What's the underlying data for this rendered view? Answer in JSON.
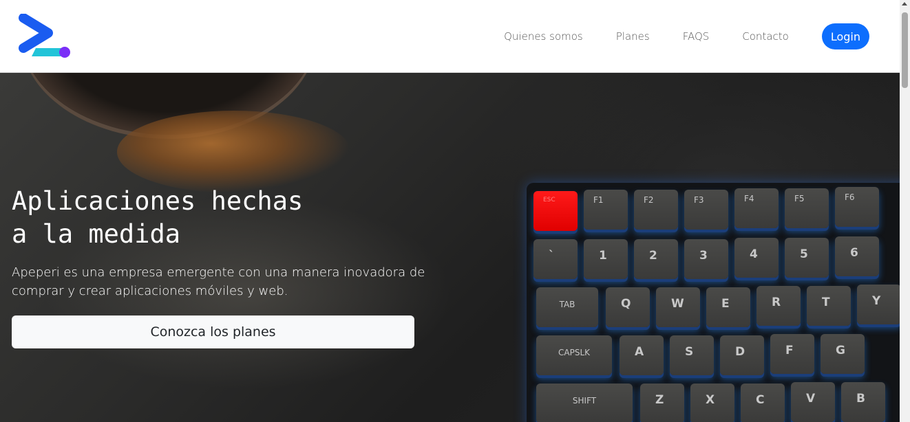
{
  "nav": {
    "links": [
      "Quienes somos",
      "Planes",
      "FAQS",
      "Contacto"
    ],
    "login_label": "Login"
  },
  "hero": {
    "title_line1": "Aplicaciones hechas",
    "title_line2": "a la medida",
    "subtitle": "Apeperi es una empresa emergente con una manera inovadora de comprar y crear aplicaciones móviles y web.",
    "cta_label": "Conozca los planes"
  },
  "keyboard": {
    "function_row": [
      "ESC",
      "F1",
      "F2",
      "F3",
      "F4",
      "F5",
      "F6"
    ],
    "number_row": [
      "`",
      "1",
      "2",
      "3",
      "4",
      "5",
      "6"
    ],
    "qwerty_row": [
      "TAB",
      "Q",
      "W",
      "E",
      "R",
      "T",
      "Y"
    ],
    "home_row": [
      "CAPSLK",
      "A",
      "S",
      "D",
      "F",
      "G"
    ],
    "bottom_row": [
      "SHIFT",
      "Z",
      "X",
      "C",
      "V",
      "B"
    ]
  },
  "colors": {
    "accent": "#0d6efd",
    "logo_blue": "#1a5cf0",
    "logo_cyan": "#22c4d8",
    "logo_purple": "#7b2ff7",
    "esc_key": "#ff1a1a"
  }
}
